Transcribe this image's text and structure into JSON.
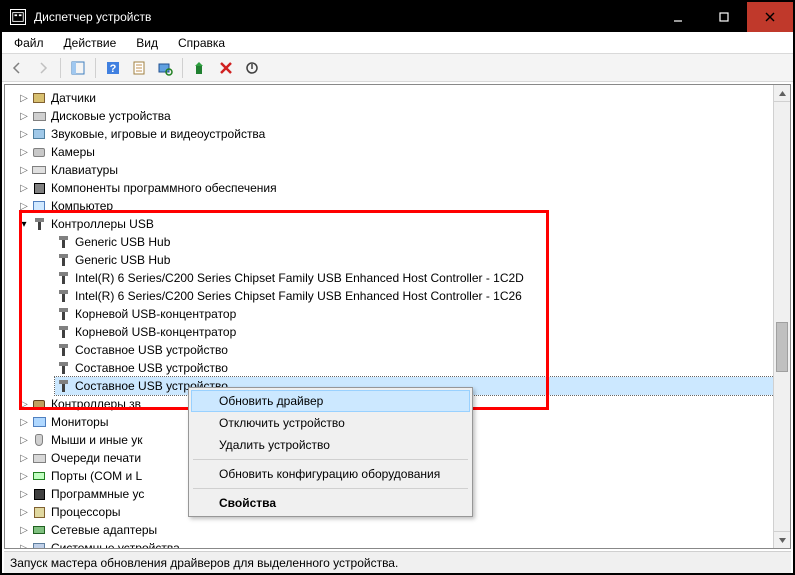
{
  "title": "Диспетчер устройств",
  "menu": {
    "file": "Файл",
    "action": "Действие",
    "view": "Вид",
    "help": "Справка"
  },
  "tree": {
    "sensors": "Датчики",
    "disks": "Дисковые устройства",
    "sound": "Звуковые, игровые и видеоустройства",
    "cameras": "Камеры",
    "keyboards": "Клавиатуры",
    "software": "Компоненты программного обеспечения",
    "computer": "Компьютер",
    "usb": "Контроллеры USB",
    "usb_items": [
      "Generic USB Hub",
      "Generic USB Hub",
      "Intel(R) 6 Series/C200 Series Chipset Family USB Enhanced Host Controller - 1C2D",
      "Intel(R) 6 Series/C200 Series Chipset Family USB Enhanced Host Controller - 1C26",
      "Корневой USB-концентратор",
      "Корневой USB-концентратор",
      "Составное USB устройство",
      "Составное USB устройство",
      "Составное USB устройство"
    ],
    "sndctrl": "Контроллеры зв",
    "monitors": "Мониторы",
    "mice": "Мыши и иные ук",
    "printq": "Очереди печати",
    "ports": "Порты (COM и L",
    "soft2": "Программные ус",
    "cpus": "Процессоры",
    "net": "Сетевые адаптеры",
    "sys": "Системные устройства"
  },
  "ctx": {
    "update": "Обновить драйвер",
    "disable": "Отключить устройство",
    "uninstall": "Удалить устройство",
    "scan": "Обновить конфигурацию оборудования",
    "props": "Свойства"
  },
  "status": "Запуск мастера обновления драйверов для выделенного устройства."
}
